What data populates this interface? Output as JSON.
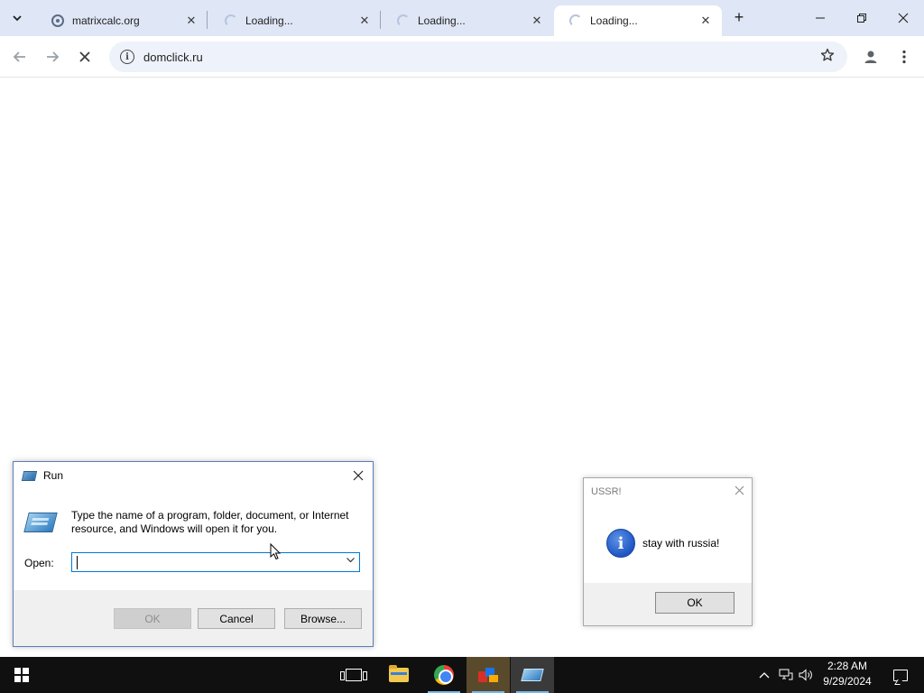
{
  "browser": {
    "tabs": [
      {
        "title": "matrixcalc.org",
        "state": "loaded",
        "active": false
      },
      {
        "title": "Loading...",
        "state": "loading",
        "active": false
      },
      {
        "title": "Loading...",
        "state": "loading",
        "active": false
      },
      {
        "title": "Loading...",
        "state": "loading",
        "active": true
      }
    ],
    "new_tab_label": "+",
    "url": "domclick.ru",
    "window_controls": {
      "minimize": "—",
      "restore": "❐",
      "close": "✕"
    }
  },
  "run_dialog": {
    "title": "Run",
    "description": "Type the name of a program, folder, document, or Internet resource, and Windows will open it for you.",
    "open_label": "Open:",
    "open_value": "",
    "buttons": {
      "ok": "OK",
      "cancel": "Cancel",
      "browse": "Browse..."
    }
  },
  "message_box": {
    "title": "USSR!",
    "text": "stay with russia!",
    "ok": "OK",
    "icon": "info-icon"
  },
  "taskbar": {
    "items": [
      "start-button",
      "task-view-icon",
      "file-explorer-icon",
      "chrome-icon",
      "app-icon",
      "run-icon"
    ],
    "clock_time": "2:28 AM",
    "clock_date": "9/29/2024"
  },
  "colors": {
    "tabstrip": "#dfe6f6",
    "omnibox": "#eef2fa",
    "taskbar": "#101010",
    "accent": "#0078d7"
  }
}
